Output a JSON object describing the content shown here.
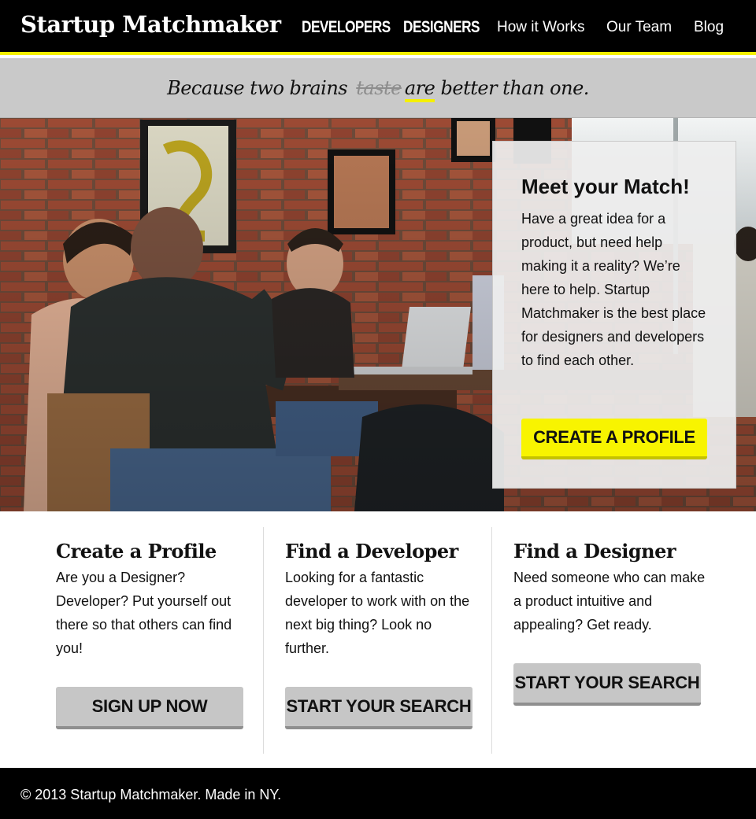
{
  "header": {
    "brand": "Startup Matchmaker",
    "nav": [
      "DEVELOPERS",
      "DESIGNERS",
      "How it Works",
      "Our Team",
      "Blog"
    ]
  },
  "tagline": {
    "before": "Because two brains",
    "struck": "taste",
    "underlined": "are",
    "after": "better than one."
  },
  "hero": {
    "title": "Meet your Match!",
    "text": "Have a great idea for a product, but need help making it a reality? We’re here to help. Startup Matchmaker is the best place for designers and developers to find each other.",
    "button": "CREATE A PROFILE"
  },
  "features": [
    {
      "title": "Create a Profile",
      "text": "Are you a Designer? Developer? Put yourself out there so that others can find you!",
      "button": "SIGN UP NOW"
    },
    {
      "title": "Find a Developer",
      "text": "Looking for a fantastic developer to work with on the next big thing? Look no further.",
      "button": "START YOUR SEARCH"
    },
    {
      "title": "Find a Designer",
      "text": "Need someone who can make a product intuitive and appealing? Get ready.",
      "button": "START YOUR SEARCH"
    }
  ],
  "footer": {
    "text": "© 2013 Startup Matchmaker. Made in NY."
  },
  "colors": {
    "accent_yellow": "#f8f400",
    "header_bg": "#000000",
    "tagline_bg": "#c9c9c9",
    "button_gray": "#c6c6c6"
  }
}
